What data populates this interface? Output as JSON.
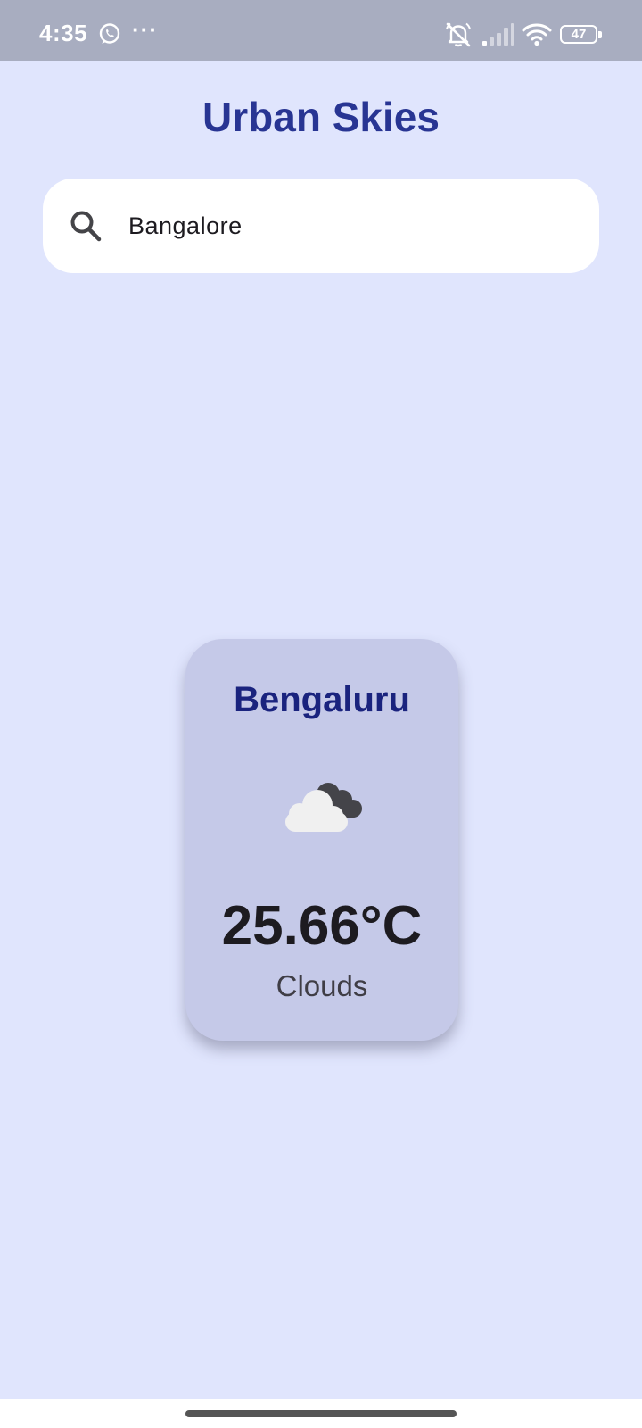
{
  "status_bar": {
    "time": "4:35",
    "more": "···",
    "battery": "47",
    "icons": [
      "whatsapp-icon",
      "mute-icon",
      "signal-icon",
      "wifi-icon",
      "battery-icon"
    ]
  },
  "app": {
    "title": "Urban Skies"
  },
  "search": {
    "value": "Bangalore",
    "icon": "search-icon"
  },
  "weather": {
    "city": "Bengaluru",
    "icon": "cloudy-icon",
    "temperature": "25.66°C",
    "condition": "Clouds"
  },
  "colors": {
    "background": "#e0e5fd",
    "status_bar": "#a8adc0",
    "title": "#283593",
    "card": "#c5c9e8",
    "city": "#1a237e"
  }
}
